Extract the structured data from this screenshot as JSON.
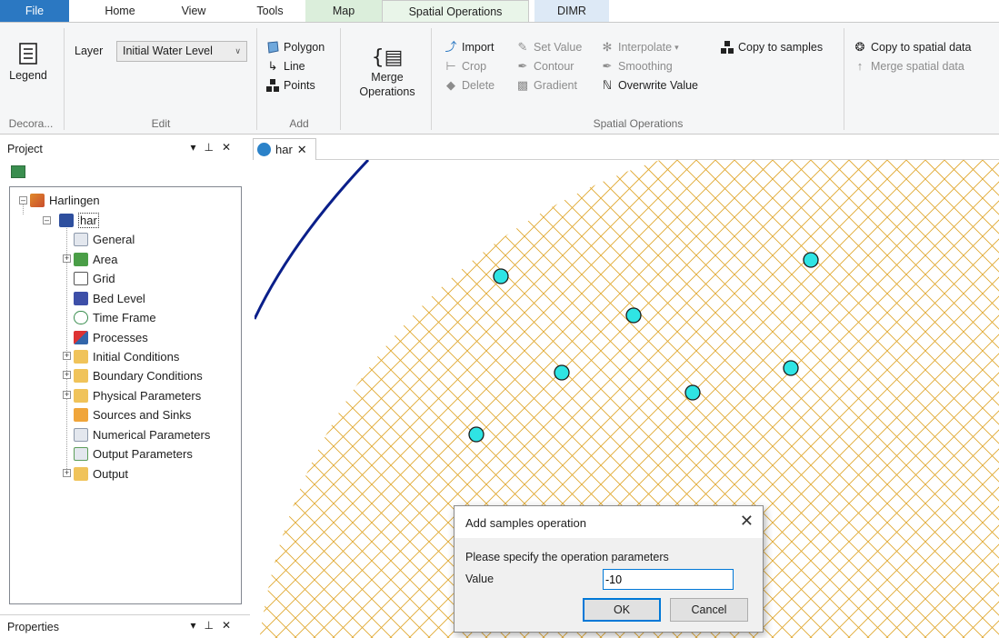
{
  "ribbon_tabs": [
    "File",
    "Home",
    "View",
    "Tools",
    "Map",
    "Spatial Operations",
    "DIMR"
  ],
  "ribbon": {
    "legend_label": "Legend",
    "decorations_label": "Decora...",
    "layer_label": "Layer",
    "layer_value": "Initial Water Level",
    "edit_label": "Edit",
    "add_polygon": "Polygon",
    "add_line": "Line",
    "add_points": "Points",
    "add_label": "Add",
    "merge_line1": "Merge",
    "merge_line2": "Operations",
    "import": "Import",
    "set_value": "Set Value",
    "interpolate": "Interpolate",
    "crop": "Crop",
    "contour": "Contour",
    "smoothing": "Smoothing",
    "delete": "Delete",
    "gradient": "Gradient",
    "overwrite_value": "Overwrite Value",
    "copy_to_samples": "Copy to samples",
    "copy_to_spatial_data": "Copy to spatial data",
    "merge_spatial_data": "Merge spatial data",
    "spatial_operations_label": "Spatial Operations"
  },
  "project_panel": {
    "title": "Project",
    "tree": {
      "root": "Harlingen",
      "model": "har",
      "children": [
        "General",
        "Area",
        "Grid",
        "Bed Level",
        "Time Frame",
        "Processes",
        "Initial Conditions",
        "Boundary Conditions",
        "Physical Parameters",
        "Sources and Sinks",
        "Numerical Parameters",
        "Output Parameters",
        "Output"
      ]
    }
  },
  "properties_panel": {
    "title": "Properties"
  },
  "document_tab": {
    "label": "har"
  },
  "map": {
    "grid_color": "#e0a830",
    "sample_color": "#2fe4e4",
    "boundary_color": "#0a1f8a",
    "sample_point_count": 8
  },
  "dialog": {
    "title": "Add samples operation",
    "prompt": "Please specify the operation parameters",
    "value_label": "Value",
    "value": "-10",
    "ok": "OK",
    "cancel": "Cancel"
  }
}
